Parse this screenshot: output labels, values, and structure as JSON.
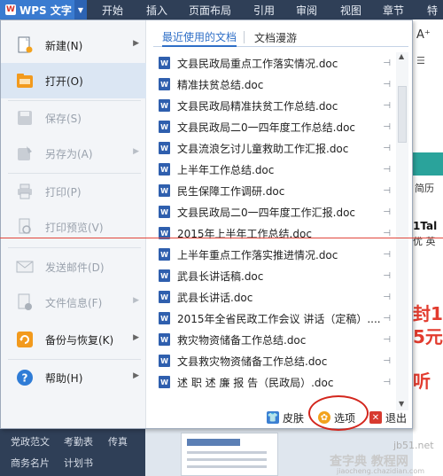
{
  "app": {
    "title": "WPS 文字"
  },
  "ribbon_tabs": [
    "开始",
    "插入",
    "页面布局",
    "引用",
    "审阅",
    "视图",
    "章节",
    "特"
  ],
  "menu_items": [
    {
      "label": "新建(N)",
      "has_arrow": true,
      "disabled": false,
      "icon": "new-document-icon"
    },
    {
      "label": "打开(O)",
      "has_arrow": false,
      "disabled": false,
      "icon": "open-folder-icon"
    },
    {
      "label": "保存(S)",
      "has_arrow": false,
      "disabled": true,
      "icon": "save-icon"
    },
    {
      "label": "另存为(A)",
      "has_arrow": true,
      "disabled": true,
      "icon": "save-as-icon"
    },
    {
      "label": "打印(P)",
      "has_arrow": false,
      "disabled": true,
      "icon": "print-icon"
    },
    {
      "label": "打印预览(V)",
      "has_arrow": false,
      "disabled": true,
      "icon": "print-preview-icon"
    },
    {
      "label": "发送邮件(D)",
      "has_arrow": false,
      "disabled": true,
      "icon": "mail-icon"
    },
    {
      "label": "文件信息(F)",
      "has_arrow": true,
      "disabled": true,
      "icon": "file-info-icon"
    },
    {
      "label": "备份与恢复(K)",
      "has_arrow": true,
      "disabled": false,
      "icon": "backup-icon"
    },
    {
      "label": "帮助(H)",
      "has_arrow": true,
      "disabled": false,
      "icon": "help-icon"
    }
  ],
  "tabs": {
    "recent": "最近使用的文档",
    "roam": "文档漫游"
  },
  "recent_docs": [
    "文县民政局重点工作落实情况.doc",
    "精准扶贫总结.doc",
    "文县民政局精准扶贫工作总结.doc",
    "文县民政局二0一四年度工作总结.doc",
    "文县流浪乞讨儿童救助工作汇报.doc",
    "上半年工作总结.doc",
    "民生保障工作调研.doc",
    "文县民政局二0一四年度工作汇报.doc",
    "2015年上半年工作总结.doc",
    "上半年重点工作落实推进情况.doc",
    "武县长讲话稿.doc",
    "武县长讲话.doc",
    "2015年全省民政工作会议 讲话（定稿）....",
    "救灾物资储备工作总结.doc",
    "文县救灾物资储备工作总结.doc",
    "述 职 述 廉 报 告（民政局）.doc"
  ],
  "footer": {
    "skin": "皮肤",
    "options": "选项",
    "exit": "退出"
  },
  "bottom_left": [
    "党政范文",
    "考勤表",
    "传真",
    "商务名片",
    "计划书"
  ],
  "background_right": {
    "aa": "A⁺",
    "resume": "简历",
    "promo_a": "1Tal",
    "promo_b": "优 英",
    "red_a": "封1",
    "red_b": "5元",
    "red_c": "听"
  },
  "watermark": {
    "site": "jb51.net",
    "title": "查字典 教程网",
    "url": "jiaocheng.chazidian.com"
  },
  "colors": {
    "accent_blue": "#2f6fc7",
    "highlight_ring": "#d3261d",
    "ribbon_bg": "#2f3f57"
  }
}
